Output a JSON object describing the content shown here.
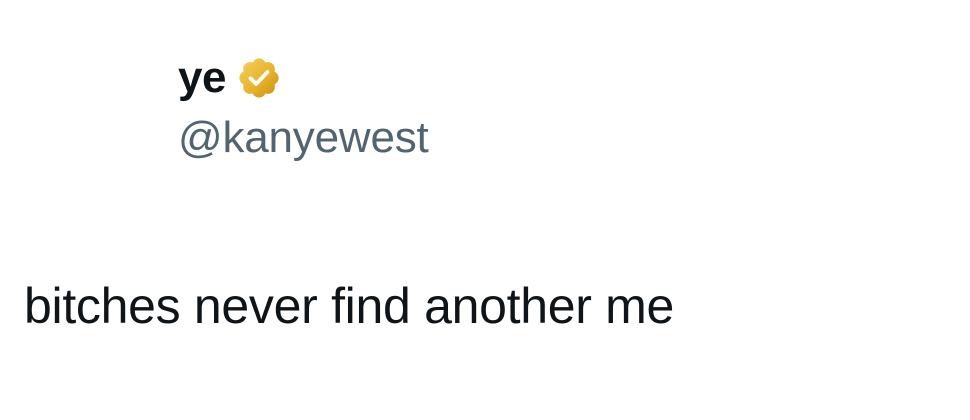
{
  "author": {
    "display_name": "ye",
    "handle": "@kanyewest",
    "verified_badge": {
      "icon": "verified-badge-icon",
      "color": "#E8B32C",
      "check_color": "#ffffff"
    }
  },
  "tweet": {
    "text": "bitches never find another me"
  },
  "colors": {
    "text_primary": "#0f1419",
    "text_secondary": "#536471",
    "background": "#ffffff"
  }
}
